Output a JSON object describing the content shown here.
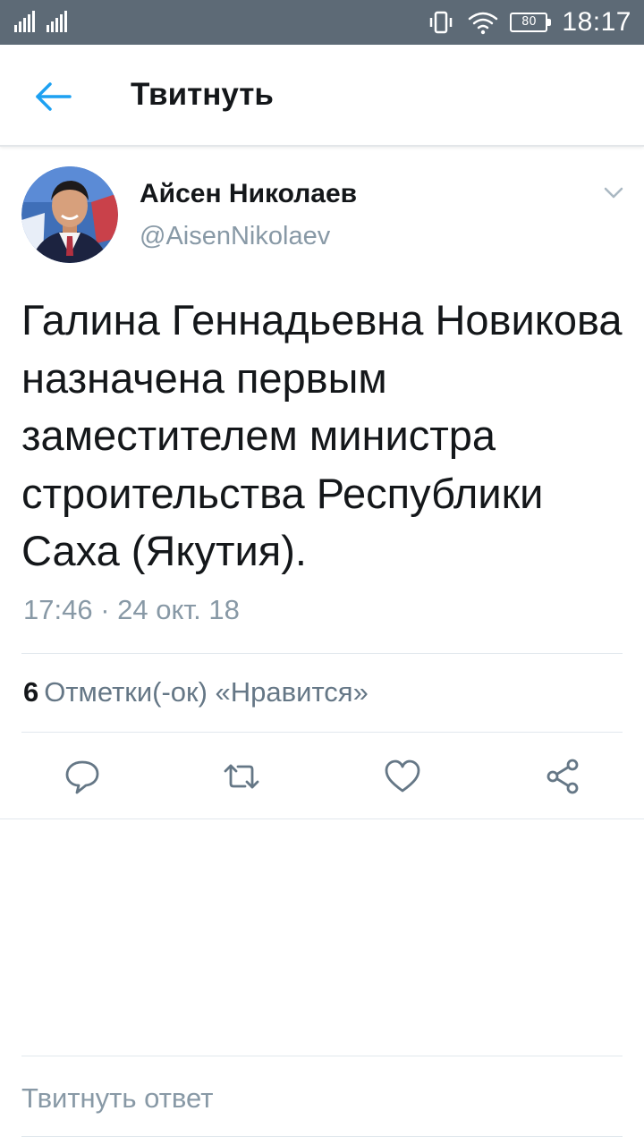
{
  "status_bar": {
    "battery": "80",
    "time": "18:17"
  },
  "header": {
    "title": "Твитнуть"
  },
  "tweet": {
    "author_name": "Айсен Николаев",
    "author_handle": "@AisenNikolaev",
    "text": "Галина Геннадьевна Новикова назначена первым заместителем министра строительства Республики Саха (Якутия).",
    "timestamp": "17:46 · 24 окт. 18",
    "likes_count": "6",
    "likes_label": "Отметки(-ок) «Нравится»"
  },
  "reply": {
    "placeholder": "Твитнуть ответ"
  },
  "colors": {
    "accent": "#1da1f2",
    "status_bar": "#5d6a76",
    "icon_gray": "#657786"
  }
}
